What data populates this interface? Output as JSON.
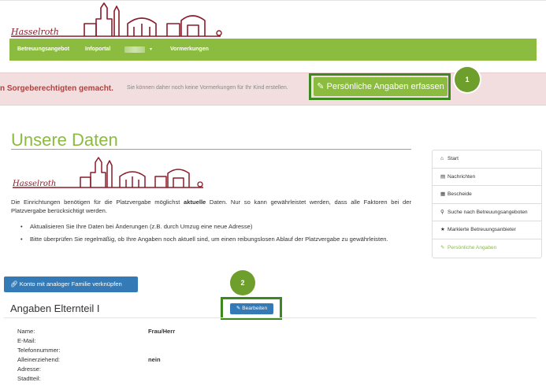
{
  "colors": {
    "brand_green": "#8bbb3f",
    "badge_green": "#6e9e2c",
    "logo_red": "#8a1c2b",
    "button_blue": "#337ab7",
    "alert_bg": "#f2dede",
    "alert_text": "#a94442"
  },
  "logo": {
    "text": "Hasselroth"
  },
  "nav": {
    "items": [
      "Betreuungsangebot",
      "Infoportal",
      "Vormerkungen"
    ],
    "caret": "▾"
  },
  "alert": {
    "bold_text": "n Sorgeberechtigten gemacht.",
    "text": "Sie können daher noch keine Vormerkungen für Ihr Kind erstellen.",
    "button_label": "Persönliche Angaben erfassen",
    "button_icon": "pencil-icon",
    "badge": "1"
  },
  "main": {
    "title": "Unsere Daten",
    "para_before": "Die Einrichtungen benötigen für die Platzvergabe möglichst",
    "para_bold": "aktuelle",
    "para_after": "Daten. Nur so kann gewährleistet werden, dass alle Faktoren bei der Platzvergabe berücksichtigt werden.",
    "bullets": [
      "Aktualisieren Sie Ihre Daten bei Änderungen (z.B. durch Umzug eine neue Adresse)",
      "Bitte überprüfen Sie regelmäßig, ob Ihre Angaben noch aktuell sind, um einen reibungslosen Ablauf der Platzvergabe zu gewährleisten."
    ]
  },
  "sidenav": {
    "items": [
      {
        "label": "Start",
        "icon": "home-icon",
        "glyph": "⌂"
      },
      {
        "label": "Nachrichten",
        "icon": "inbox-icon",
        "glyph": "▤"
      },
      {
        "label": "Bescheide",
        "icon": "list-icon",
        "glyph": "▦"
      },
      {
        "label": "Suche nach Betreuungsangeboten",
        "icon": "search-icon",
        "glyph": "⚲"
      },
      {
        "label": "Markierte Betreuungsanbieter",
        "icon": "star-icon",
        "glyph": "★"
      },
      {
        "label": "Persönliche Angaben",
        "icon": "pencil-icon",
        "glyph": "✎"
      }
    ]
  },
  "link_button": {
    "label": "Konto mit analoger Familie verknüpfen",
    "icon": "link-icon"
  },
  "parent_section": {
    "title": "Angaben Elternteil I",
    "edit_label": "Bearbeiten",
    "badge": "2",
    "fields": [
      {
        "label": "Name:",
        "value": "Frau/Herr"
      },
      {
        "label": "E-Mail:",
        "value": ""
      },
      {
        "label": "Telefonnummer:",
        "value": ""
      },
      {
        "label": "Alleinerziehend:",
        "value": "nein"
      },
      {
        "label": "Adresse:",
        "value": ""
      },
      {
        "label": "Stadtteil:",
        "value": ""
      }
    ]
  }
}
